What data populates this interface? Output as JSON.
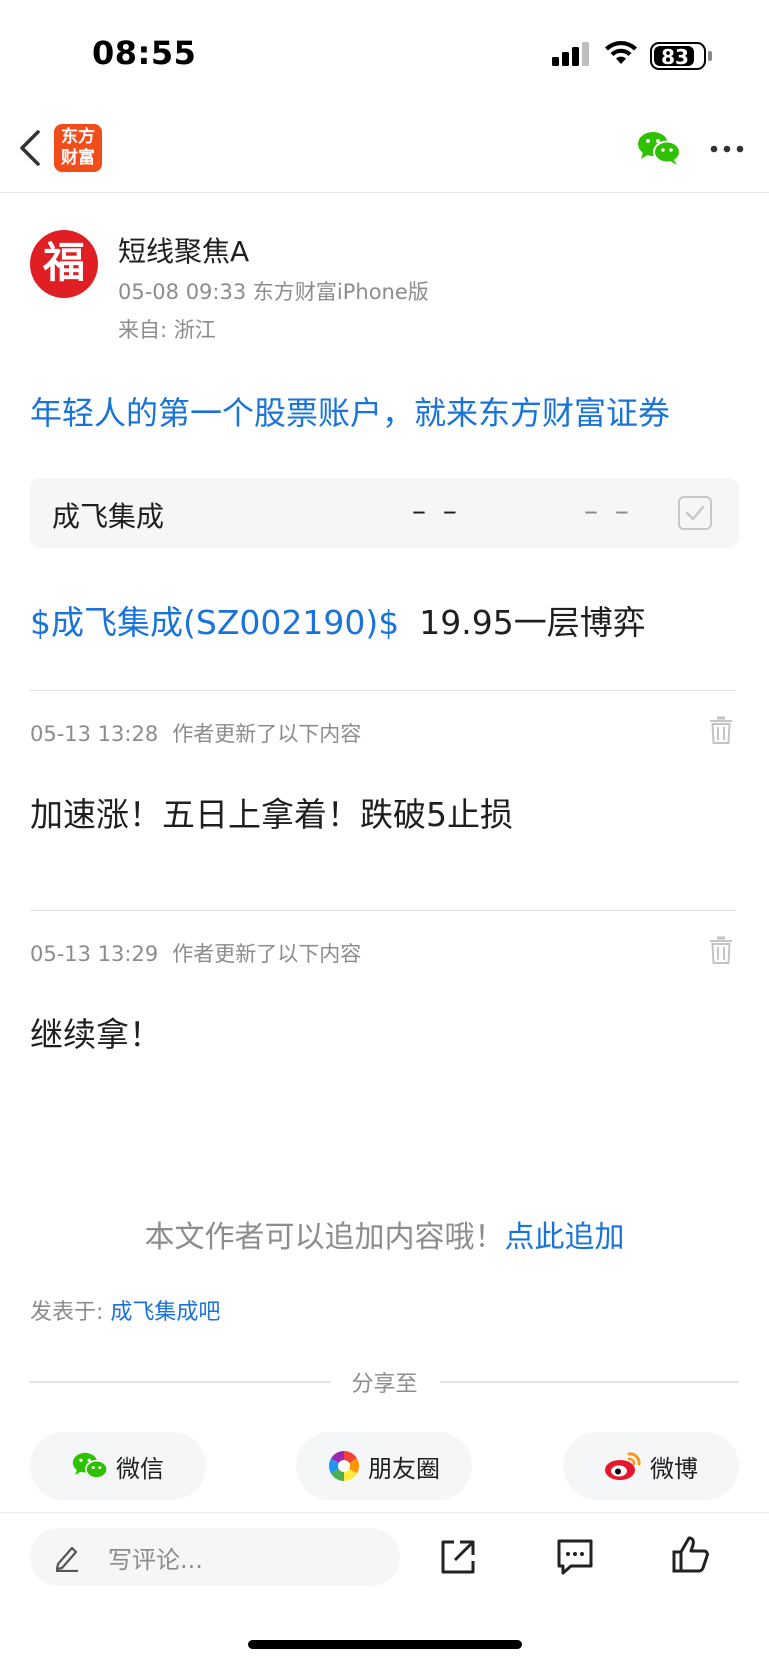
{
  "status_bar": {
    "time": "08:55",
    "battery": "83",
    "battery_level": 0.83
  },
  "nav": {
    "logo_line1": "东方",
    "logo_line2": "财富"
  },
  "author": {
    "avatar_char": "福",
    "name": "短线聚焦A",
    "meta": "05-08 09:33 东方财富iPhone版",
    "from": "来自: 浙江"
  },
  "promo": "年轻人的第一个股票账户，就来东方财富证券",
  "stock_card": {
    "name": "成飞集成",
    "price": "– –",
    "change": "– –"
  },
  "post": {
    "stock_link": "$成飞集成(SZ002190)$",
    "text": "19.95一层博弈"
  },
  "updates": [
    {
      "time": "05-13 13:28",
      "label": "作者更新了以下内容",
      "text": "加速涨！五日上拿着！跌破5止损"
    },
    {
      "time": "05-13 13:29",
      "label": "作者更新了以下内容",
      "text": "继续拿！"
    }
  ],
  "append": {
    "text": "本文作者可以追加内容哦！",
    "link": "点此追加"
  },
  "posted": {
    "label": "发表于: ",
    "link": "成飞集成吧"
  },
  "share": {
    "title": "分享至",
    "buttons": [
      {
        "label": "微信",
        "icon": "wechat-icon"
      },
      {
        "label": "朋友圈",
        "icon": "moments-icon"
      },
      {
        "label": "微博",
        "icon": "weibo-icon"
      }
    ]
  },
  "bottom_bar": {
    "comment_placeholder": "写评论..."
  },
  "colors": {
    "accent": "#1a73d9",
    "brand": "#f24c1a",
    "avatar": "#e01f24",
    "wechat": "#2dc100"
  }
}
